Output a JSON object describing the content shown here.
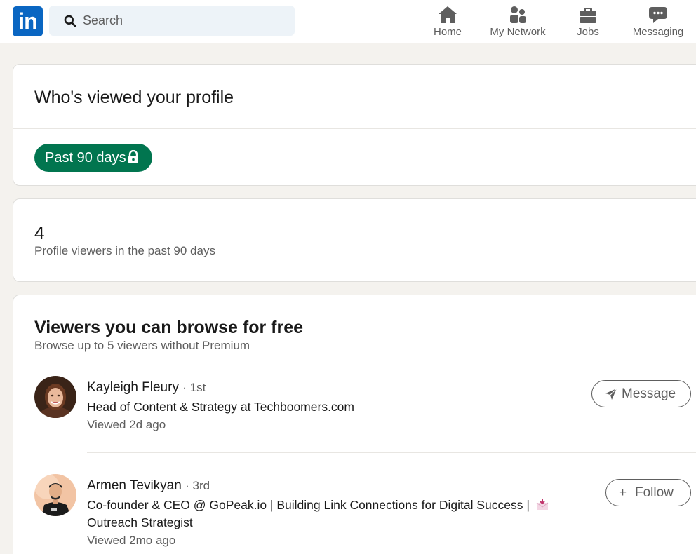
{
  "logo": {
    "text": "in"
  },
  "search": {
    "placeholder": "Search"
  },
  "nav": {
    "home": "Home",
    "network": "My Network",
    "jobs": "Jobs",
    "messaging": "Messaging"
  },
  "header_card": {
    "title": "Who's viewed your profile",
    "filter_label": "Past 90 days"
  },
  "stats_card": {
    "count": "4",
    "label": "Profile viewers in the past 90 days"
  },
  "browse_card": {
    "title": "Viewers you can browse for free",
    "subtitle": "Browse up to 5 viewers without Premium",
    "viewers": [
      {
        "name": "Kayleigh Fleury",
        "degree": "· 1st",
        "headline": "Head of Content & Strategy at Techboomers.com",
        "viewed": "Viewed 2d ago",
        "action": "Message"
      },
      {
        "name": "Armen Tevikyan",
        "degree": "· 3rd",
        "headline": "Co-founder & CEO @ GoPeak.io | Building Link Connections for Digital Success |",
        "headline2": "Outreach Strategist",
        "viewed": "Viewed 2mo ago",
        "action": "Follow",
        "action_prefix": "+"
      }
    ]
  },
  "colors": {
    "brand": "#0a66c2",
    "pill": "#01754f",
    "muted": "#5e5e5e",
    "background": "#f4f2ee"
  },
  "icons": {
    "search": "search-icon",
    "home": "home-icon",
    "network": "network-icon",
    "jobs": "briefcase-icon",
    "messaging": "chat-icon",
    "lock": "lock-icon",
    "send": "send-icon",
    "envelope": "envelope-icon"
  }
}
